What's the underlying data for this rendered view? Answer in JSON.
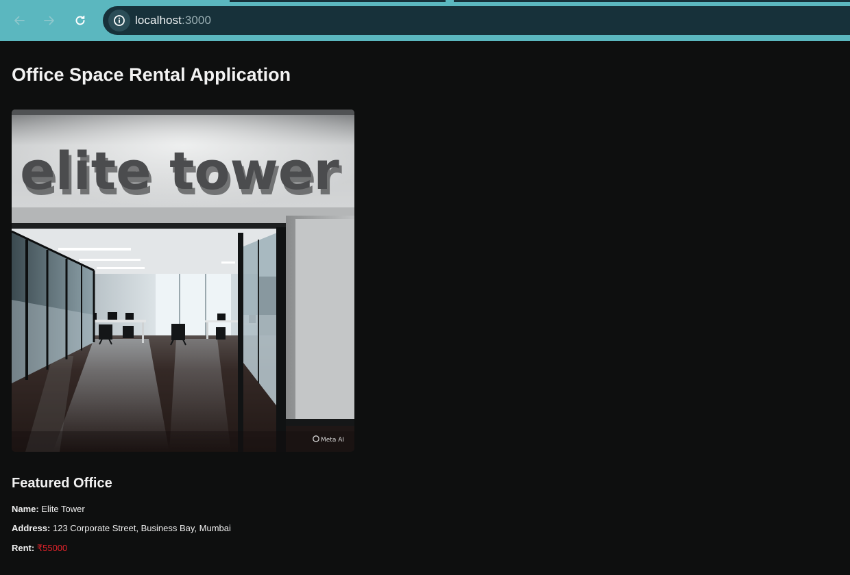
{
  "browser": {
    "url_host": "localhost",
    "url_port": ":3000",
    "icons": {
      "back": "arrow-left-icon",
      "forward": "arrow-right-icon",
      "reload": "reload-icon",
      "site_info": "info-icon"
    },
    "colors": {
      "frame": "#5bb7bf",
      "omnibox": "#17313a"
    }
  },
  "page": {
    "title": "Office Space Rental Application",
    "background": "#0e0f0f"
  },
  "hero_image": {
    "sign_text": "elite tower",
    "watermark": "Meta AI"
  },
  "featured": {
    "heading": "Featured Office",
    "name_label": "Name:",
    "name_value": "Elite Tower",
    "address_label": "Address:",
    "address_value": "123 Corporate Street, Business Bay, Mumbai",
    "rent_label": "Rent:",
    "rent_value": "₹55000",
    "rent_color": "#e5232b"
  }
}
